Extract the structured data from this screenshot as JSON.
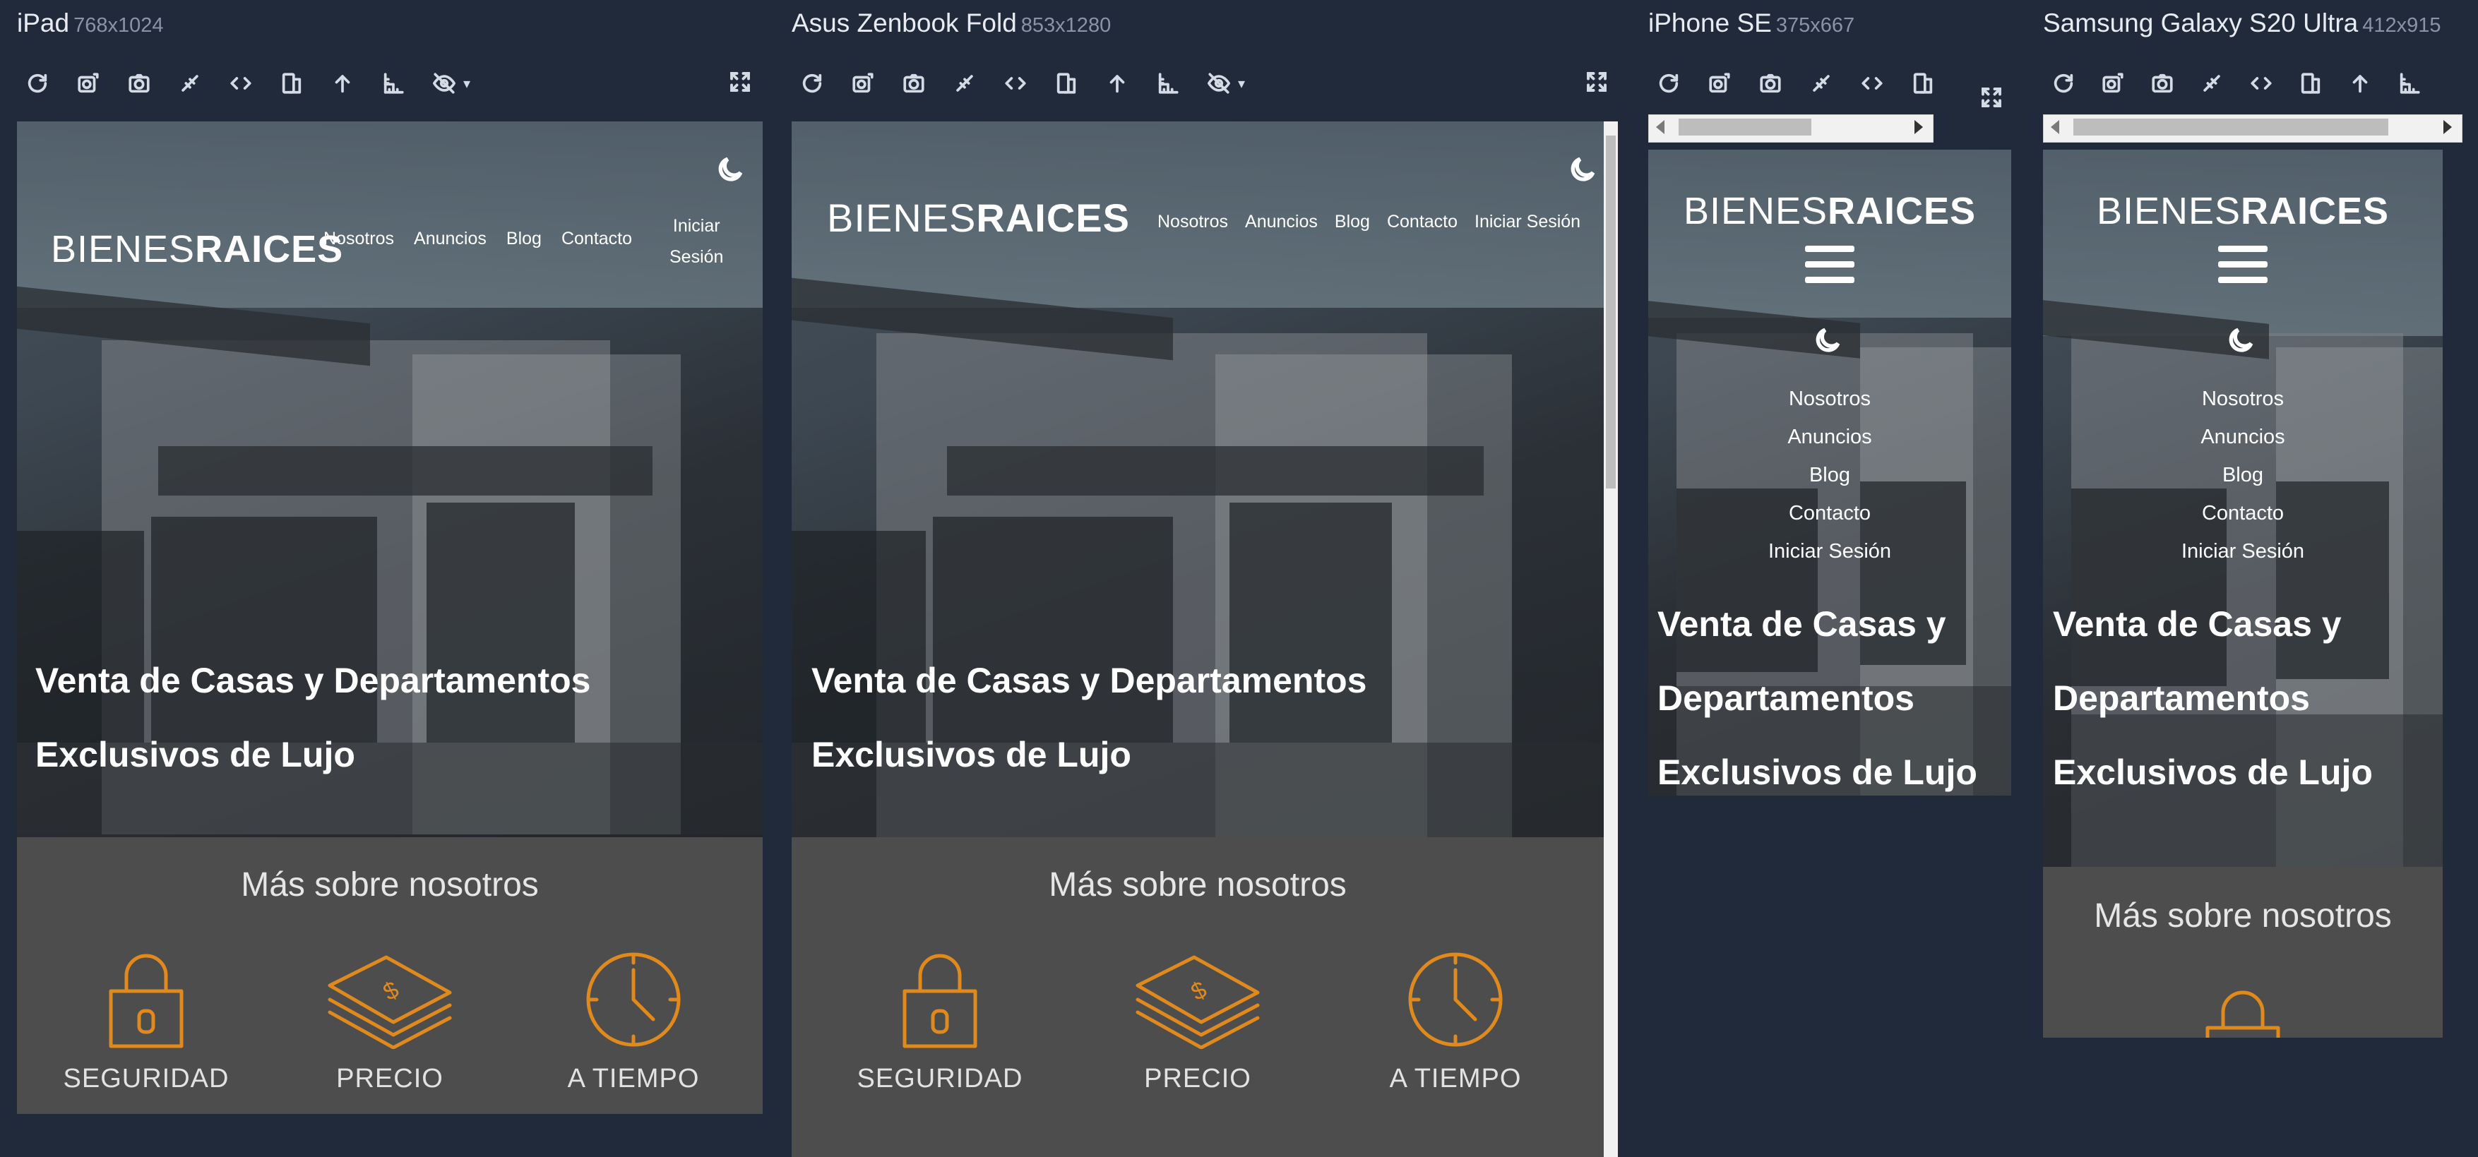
{
  "devices": [
    {
      "name": "iPad",
      "size": "768x1024"
    },
    {
      "name": "Asus Zenbook Fold",
      "size": "853x1280"
    },
    {
      "name": "iPhone SE",
      "size": "375x667"
    },
    {
      "name": "Samsung Galaxy S20 Ultra",
      "size": "412x915"
    }
  ],
  "toolbar": {
    "icons": [
      "refresh-icon",
      "rotate-capture-icon",
      "screenshot-icon",
      "link-sync-icon",
      "code-icon",
      "device-frame-icon",
      "scroll-top-icon",
      "ruler-icon",
      "hide-icon",
      "expand-icon"
    ]
  },
  "site": {
    "brand_light": "BIENES",
    "brand_bold": "RAICES",
    "nav": [
      "Nosotros",
      "Anuncios",
      "Blog",
      "Contacto",
      "Iniciar Sesión"
    ],
    "nav_login_line1": "Iniciar",
    "nav_login_line2": "Sesión",
    "hero_title_line1": "Venta de Casas y Departamentos",
    "hero_title_line2": "Exclusivos de Lujo",
    "hero_mobile_line1": "Venta de Casas y",
    "hero_mobile_line2": "Departamentos",
    "hero_mobile_line3": "Exclusivos de Lujo",
    "about_title": "Más sobre nosotros",
    "features": [
      "SEGURIDAD",
      "PRECIO",
      "A TIEMPO"
    ]
  },
  "colors": {
    "background": "#202a3b",
    "accent": "#e08a1e",
    "site_bg": "#4d4d4d"
  }
}
